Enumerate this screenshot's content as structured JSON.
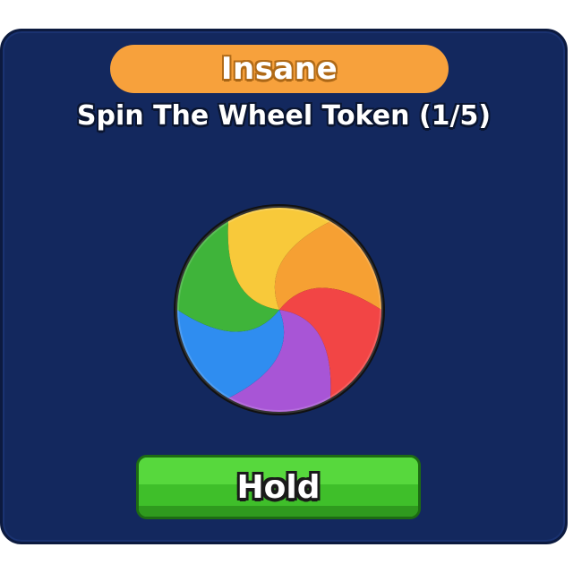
{
  "item": {
    "rarity": "Insane",
    "title": "Spin The Wheel Token (1/5)",
    "icon": "spin-wheel-token-icon"
  },
  "actions": {
    "hold_label": "Hold"
  },
  "colors": {
    "panel_bg": "#13285e",
    "rarity_badge": "#f7a13c",
    "hold_button": "#3fbf2a",
    "wheel_segments": [
      "#f6a033",
      "#f24545",
      "#a855d6",
      "#2f8df0",
      "#3fb43a",
      "#f8c93a"
    ]
  }
}
